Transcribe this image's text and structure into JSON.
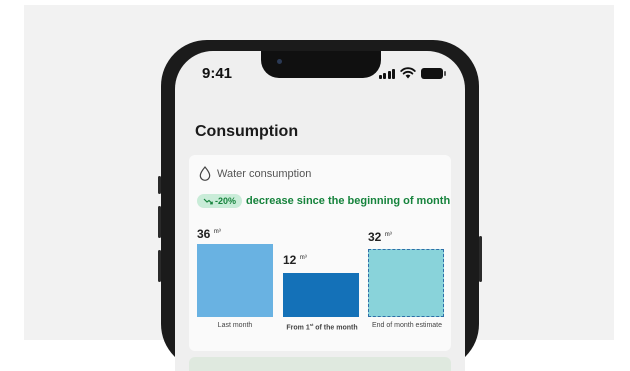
{
  "status_bar": {
    "time": "9:41"
  },
  "screen": {
    "title": "Consumption",
    "card": {
      "title": "Water consumption",
      "trend_badge": "-20%",
      "trend_text": "decrease since the beginning of month",
      "unit": "m³",
      "bars": [
        {
          "value": "36",
          "label": "Last month",
          "color": "#69b2e2",
          "style": "solid"
        },
        {
          "value": "12",
          "label_main": "From 1",
          "label_sup": "st",
          "label_tail": " of the month",
          "color": "#1471b8",
          "style": "solid"
        },
        {
          "value": "32",
          "label": "End of month estimate",
          "color": "#89d3da",
          "style": "dashed"
        }
      ]
    }
  },
  "colors": {
    "positive_green": "#16833c",
    "positive_green_bg": "#c9ecd8"
  }
}
